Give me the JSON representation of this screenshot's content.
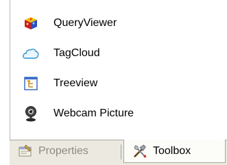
{
  "toolbox": {
    "items": [
      {
        "label": "QueryViewer",
        "icon": "cube-icon"
      },
      {
        "label": "TagCloud",
        "icon": "cloud-icon"
      },
      {
        "label": "Treeview",
        "icon": "treeview-icon"
      },
      {
        "label": "Webcam Picture",
        "icon": "webcam-icon"
      }
    ]
  },
  "tabs": {
    "properties_label": "Properties",
    "toolbox_label": "Toolbox",
    "active": "Toolbox"
  },
  "colors": {
    "tabstrip_bg": "#ebe9e0",
    "active_tab_bg": "#fcfcf9",
    "inactive_text": "#8c8a82",
    "border": "#a9a69b"
  }
}
